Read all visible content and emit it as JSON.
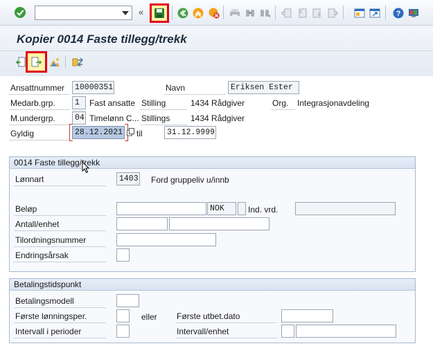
{
  "toolbar": {
    "command_field_value": "",
    "icons": [
      "enter-icon",
      "save-icon",
      "back-icon",
      "exit-icon",
      "cancel-icon",
      "print-icon",
      "find-icon",
      "find-next-icon",
      "first-page-icon",
      "previous-page-icon",
      "next-page-icon",
      "last-page-icon",
      "new-session-icon",
      "shortcut-icon",
      "help-icon",
      "customize-layout-icon"
    ]
  },
  "title": "Kopier 0014 Faste tillegg/trekk",
  "appbar": {
    "icons": [
      "previous-record-icon",
      "next-record-icon",
      "overview-icon",
      "personnel-actions-icon"
    ]
  },
  "header": {
    "ansattnummer_label": "Ansattnummer",
    "ansattnummer_value": "10000351",
    "navn_label": "Navn",
    "navn_value": "Eriksen Ester",
    "medarb_grp_label": "Medarb.grp.",
    "medarb_grp_code": "1",
    "medarb_grp_text": "Fast ansatte",
    "stilling_label": "Stilling",
    "stilling_value": "1434 Rådgiver",
    "org_label": "Org.",
    "org_value": "Integrasjonavdeling",
    "m_undergrp_label": "M.undergrp.",
    "m_undergrp_code": "04",
    "m_undergrp_text": "Timelønn C...",
    "stillings_label": "Stillings",
    "stillings_value": "1434 Rådgiver",
    "gyldig_label": "Gyldig",
    "gyldig_from": "28.12.2021",
    "til_label": "til",
    "gyldig_to": "31.12.9999"
  },
  "group1": {
    "title": "0014 Faste tillegg/trekk",
    "lonnart_label": "Lønnart",
    "lonnart_value": "1403",
    "lonnart_text": "Ford gruppeliv u/innb",
    "belop_label": "Beløp",
    "belop_value": "",
    "currency": "NOK",
    "ind_vrd_label": "Ind. vrd.",
    "ind_vrd_value": "",
    "antall_label": "Antall/enhet",
    "antall_value": "",
    "enhet_value": "",
    "tilordning_label": "Tilordningsnummer",
    "tilordning_value": "",
    "endringsarsak_label": "Endringsårsak",
    "endringsarsak_value": ""
  },
  "group2": {
    "title": "Betalingstidspunkt",
    "betalingsmodell_label": "Betalingsmodell",
    "betalingsmodell_value": "",
    "forste_lonn_label": "Første lønningsper.",
    "forste_lonn_value": "",
    "eller_label": "eller",
    "forste_utbet_label": "Første utbet.dato",
    "forste_utbet_value": "",
    "intervall_perioder_label": "Intervall i perioder",
    "intervall_perioder_value": "",
    "intervall_enhet_label": "Intervall/enhet",
    "intervall_enhet_value1": "",
    "intervall_enhet_value2": ""
  },
  "colors": {
    "highlight": "#e2001a",
    "group_header": "#dde7f3",
    "selected_field": "#b7c9e2"
  }
}
